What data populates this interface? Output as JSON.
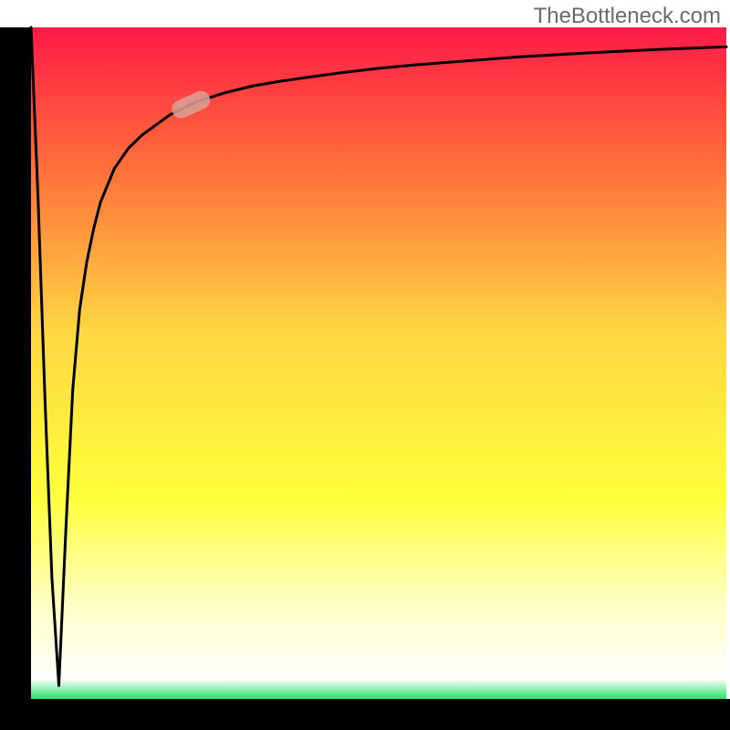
{
  "attribution": "TheBottleneck.com",
  "colors": {
    "frame": "#000000",
    "curve": "#000000",
    "marker_fill": "#d9a195",
    "gradient_top": "#ff1a47",
    "gradient_mid1": "#ff6b3a",
    "gradient_mid2": "#ffd642",
    "gradient_mid3": "#ffff3a",
    "gradient_pale": "#ffffc5",
    "gradient_bottom_edge": "#27e06e"
  },
  "chart_data": {
    "type": "line",
    "title": "",
    "xlabel": "",
    "ylabel": "",
    "xlim": [
      0,
      100
    ],
    "ylim": [
      0,
      100
    ],
    "grid": false,
    "legend": false,
    "note": "Axes have no visible tick labels; x and y are normalized 0–100 to the plot area. The curve starts at 100 at x=0, dips sharply to ~0 near x≈4, then rises quickly and asymptotes toward ~97 at the right edge. A short pill-shaped marker sits on the curve near x≈23.",
    "series": [
      {
        "name": "bottleneck-curve",
        "x": [
          0,
          1,
          2,
          3,
          4,
          5,
          6,
          7,
          8,
          9,
          10,
          12,
          14,
          16,
          18,
          20,
          22,
          24,
          28,
          32,
          36,
          40,
          45,
          50,
          55,
          60,
          70,
          80,
          90,
          100
        ],
        "values": [
          100,
          75,
          45,
          18,
          2,
          25,
          46,
          58,
          65,
          70,
          74,
          79,
          82,
          84,
          85.5,
          87,
          88,
          89,
          90.3,
          91.3,
          92,
          92.6,
          93.3,
          93.9,
          94.4,
          94.8,
          95.6,
          96.2,
          96.7,
          97.1
        ]
      }
    ],
    "marker": {
      "series": "bottleneck-curve",
      "x": 23,
      "y": 88.5,
      "shape": "pill",
      "angle_deg": 24
    }
  }
}
